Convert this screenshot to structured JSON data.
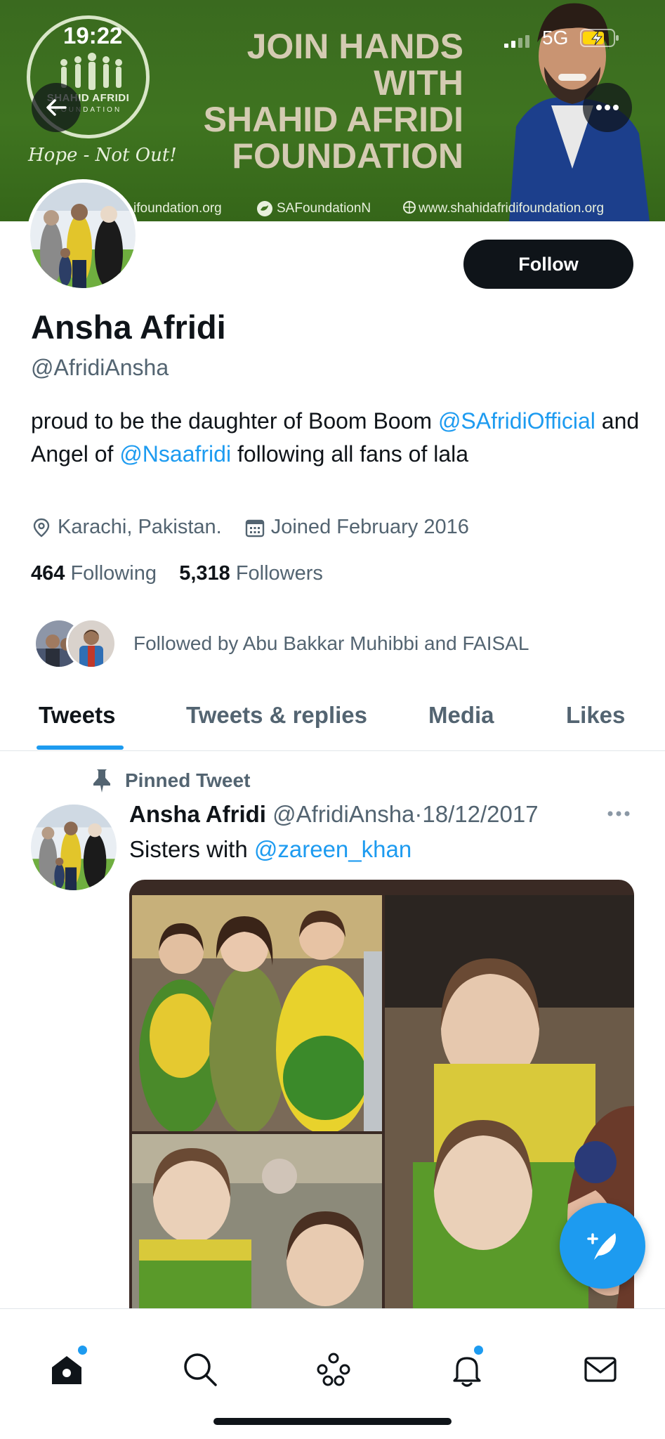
{
  "status_bar": {
    "time": "19:22",
    "network": "5G"
  },
  "banner": {
    "logo_text": "SHAHID AFRIDI",
    "logo_sub": "FOUNDATION",
    "tagline": "Hope - Not Out!",
    "headline": [
      "JOIN HANDS WITH",
      "SHAHID AFRIDI",
      "FOUNDATION"
    ],
    "links": [
      "ifoundation.org",
      "SAFoundationN",
      "www.shahidafridifoundation.org"
    ]
  },
  "profile": {
    "name": "Ansha Afridi",
    "handle": "@AfridiAnsha",
    "bio_part1": "proud to be the daughter of Boom Boom ",
    "bio_mention1": "@SAfridiOfficial",
    "bio_part2": " and Angel of ",
    "bio_mention2": "@Nsaafridi",
    "bio_part3": " following all fans of lala",
    "location": "Karachi, Pakistan.",
    "joined": "Joined February 2016",
    "following_count": "464",
    "following_label": "Following",
    "followers_count": "5,318",
    "followers_label": "Followers",
    "followed_by": "Followed by Abu Bakkar Muhibbi and FAISAL",
    "follow_label": "Follow"
  },
  "tabs": [
    {
      "label": "Tweets"
    },
    {
      "label": "Tweets & replies"
    },
    {
      "label": "Media"
    },
    {
      "label": "Likes"
    }
  ],
  "tweet": {
    "pinned_label": "Pinned Tweet",
    "author": "Ansha Afridi",
    "handle": "@AfridiAnsha",
    "separator": "·",
    "date": "18/12/2017",
    "text": "Sisters with ",
    "mention": "@zareen_khan"
  },
  "colors": {
    "accent": "#1d9bf0",
    "banner_green": "#3f7420",
    "text_primary": "#0f1419",
    "text_secondary": "#536471"
  },
  "icons": {
    "back": "arrow-left-icon",
    "more": "more-horizontal-icon",
    "location": "map-pin-icon",
    "calendar": "calendar-icon",
    "pin": "pin-icon",
    "compose": "feather-plus-icon",
    "nav": [
      "home-icon",
      "search-icon",
      "spaces-icon",
      "notifications-icon",
      "messages-icon"
    ]
  }
}
